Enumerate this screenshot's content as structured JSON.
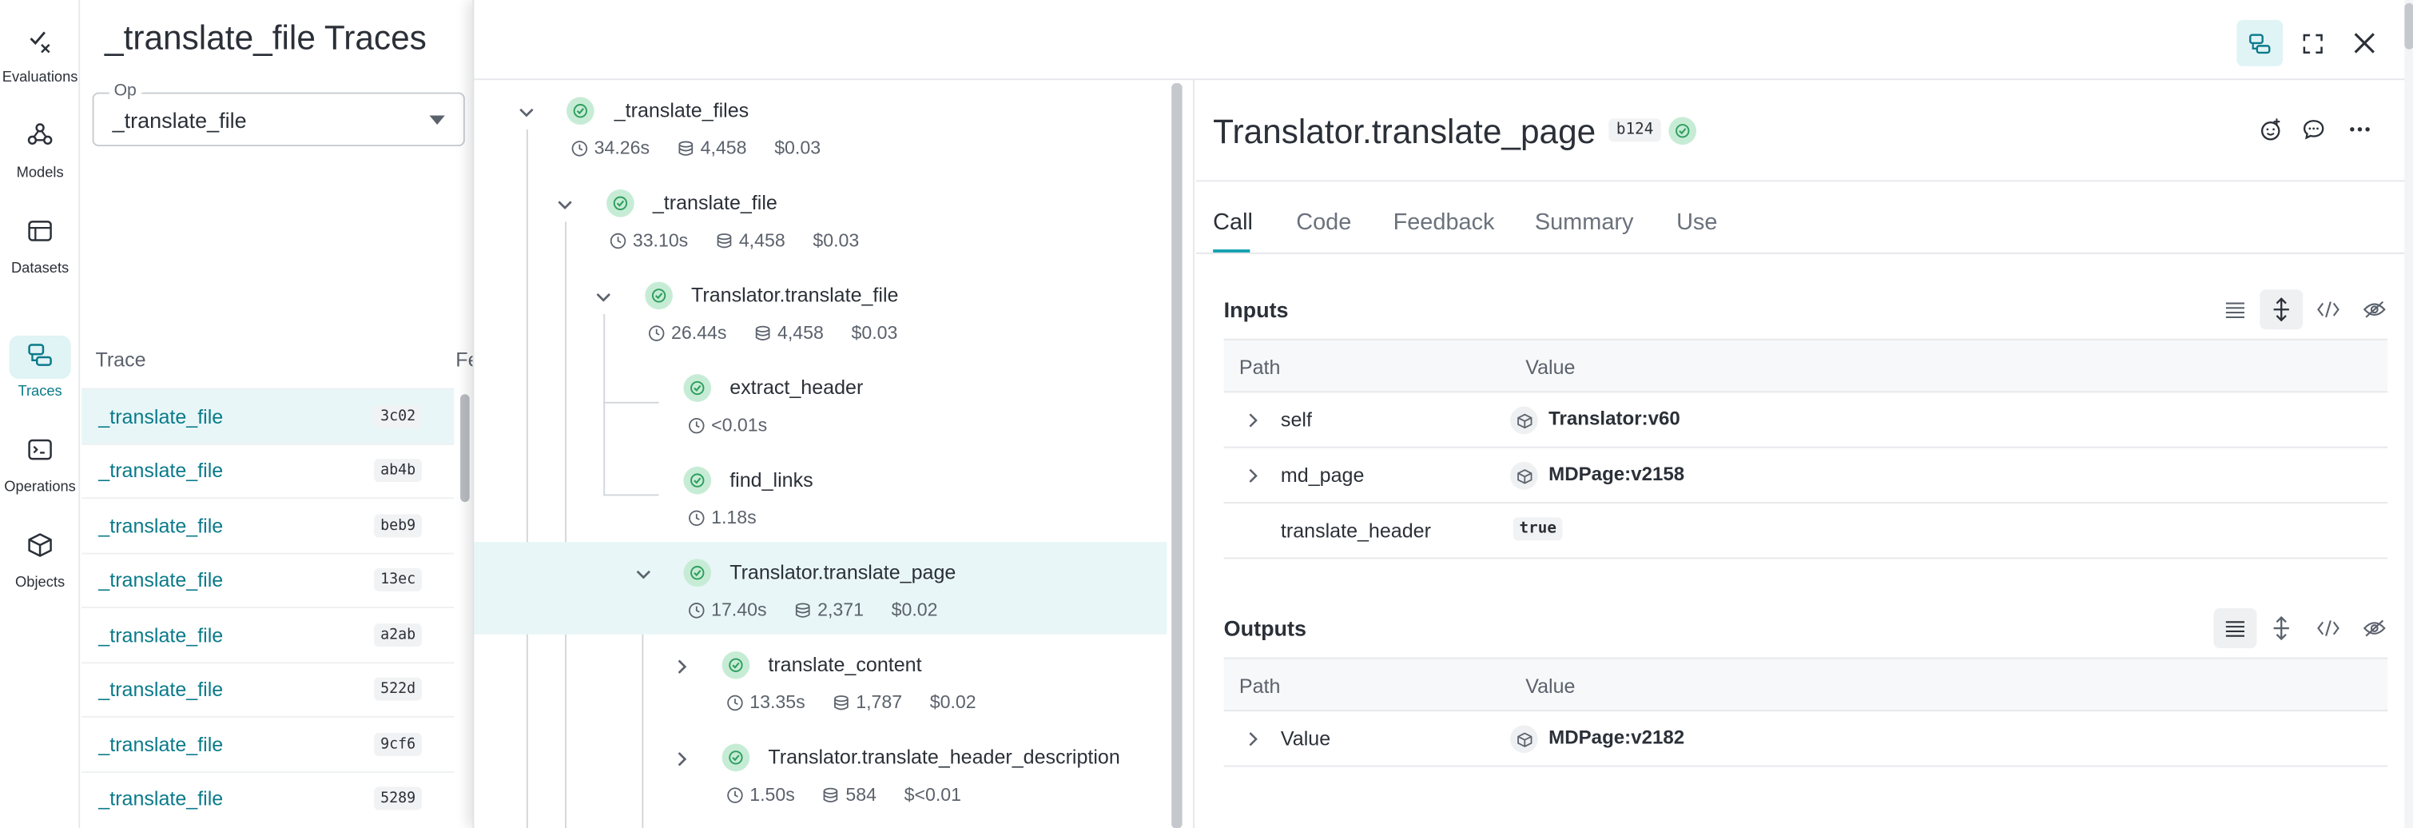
{
  "nav": {
    "items": [
      {
        "label": "Evaluations",
        "icon": "evaluations-icon"
      },
      {
        "label": "Models",
        "icon": "models-icon"
      },
      {
        "label": "Datasets",
        "icon": "datasets-icon"
      },
      {
        "label": "Traces",
        "icon": "traces-icon",
        "active": true
      },
      {
        "label": "Operations",
        "icon": "operations-icon"
      },
      {
        "label": "Objects",
        "icon": "objects-icon"
      }
    ]
  },
  "traces_panel": {
    "title": "_translate_file Traces",
    "op_filter": {
      "legend": "Op",
      "value": "_translate_file"
    },
    "columns": [
      "Trace",
      "Fe"
    ],
    "rows": [
      {
        "name": "_translate_file",
        "id": "3c02",
        "selected": true
      },
      {
        "name": "_translate_file",
        "id": "ab4b"
      },
      {
        "name": "_translate_file",
        "id": "beb9"
      },
      {
        "name": "_translate_file",
        "id": "13ec"
      },
      {
        "name": "_translate_file",
        "id": "a2ab"
      },
      {
        "name": "_translate_file",
        "id": "522d"
      },
      {
        "name": "_translate_file",
        "id": "9cf6"
      },
      {
        "name": "_translate_file",
        "id": "5289"
      }
    ]
  },
  "tree": {
    "nodes": [
      {
        "name": "_translate_files",
        "time": "34.26s",
        "tokens": "4,458",
        "cost": "$0.03",
        "expanded": true
      },
      {
        "name": "_translate_file",
        "time": "33.10s",
        "tokens": "4,458",
        "cost": "$0.03",
        "expanded": true
      },
      {
        "name": "Translator.translate_file",
        "time": "26.44s",
        "tokens": "4,458",
        "cost": "$0.03",
        "expanded": true
      },
      {
        "name": "extract_header",
        "time": "<0.01s",
        "tokens": "",
        "cost": ""
      },
      {
        "name": "find_links",
        "time": "1.18s",
        "tokens": "",
        "cost": ""
      },
      {
        "name": "Translator.translate_page",
        "time": "17.40s",
        "tokens": "2,371",
        "cost": "$0.02",
        "expanded": true,
        "selected": true
      },
      {
        "name": "translate_content",
        "time": "13.35s",
        "tokens": "1,787",
        "cost": "$0.02",
        "expanded": false
      },
      {
        "name": "Translator.translate_header_description",
        "time": "1.50s",
        "tokens": "584",
        "cost": "$<0.01",
        "expanded": false
      }
    ]
  },
  "detail": {
    "title": "Translator.translate_page",
    "badge": "b124",
    "tabs": [
      "Call",
      "Code",
      "Feedback",
      "Summary",
      "Use"
    ],
    "active_tab": "Call",
    "inputs": {
      "title": "Inputs",
      "col_path": "Path",
      "col_value": "Value",
      "rows": [
        {
          "key": "self",
          "value": "Translator:v60",
          "kind": "object",
          "expandable": true
        },
        {
          "key": "md_page",
          "value": "MDPage:v2158",
          "kind": "object",
          "expandable": true
        },
        {
          "key": "translate_header",
          "value": "true",
          "kind": "bool",
          "expandable": false
        }
      ]
    },
    "outputs": {
      "title": "Outputs",
      "col_path": "Path",
      "col_value": "Value",
      "rows": [
        {
          "key": "Value",
          "value": "MDPage:v2182",
          "kind": "object",
          "expandable": true
        }
      ]
    }
  },
  "colors": {
    "accent": "#13a0b0",
    "link": "#0a7a8a",
    "selected_bg": "#e8f6f7",
    "success": "#c7ecd6"
  }
}
